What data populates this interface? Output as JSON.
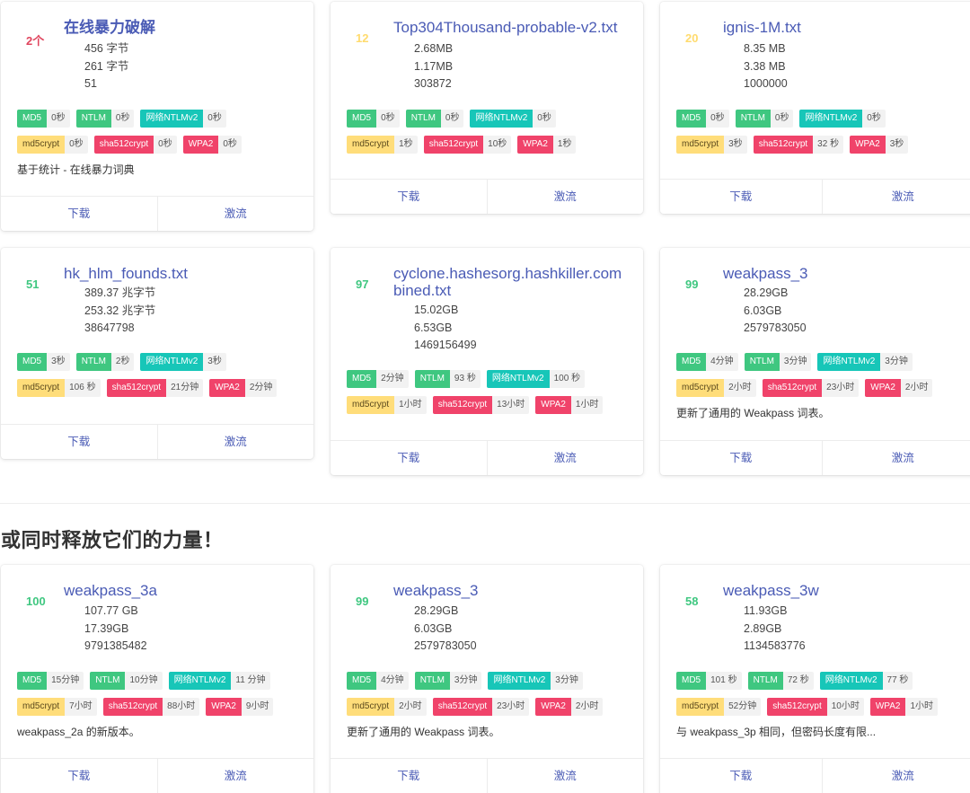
{
  "section": {
    "title": "或同时释放它们的力量！"
  },
  "labels": {
    "download": "下载",
    "torrent": "激流"
  },
  "cards": [
    {
      "rank": "2个",
      "rank_color": "#e0455e",
      "title": "在线暴力破解",
      "bold": true,
      "meta": [
        "456 字节",
        "261 字节",
        "51"
      ],
      "times": {
        "md5": "0秒",
        "ntlm": "0秒",
        "ntv2": "0秒",
        "mdc": "0秒",
        "sha": "0秒",
        "wpa": "0秒"
      },
      "desc": "基于统计 - 在线暴力词典"
    },
    {
      "rank": "12",
      "rank_color": "#ffdb6e",
      "title": "Top304Thousand-probable-v2.txt",
      "meta": [
        "2.68MB",
        "1.17MB",
        "303872"
      ],
      "times": {
        "md5": "0秒",
        "ntlm": "0秒",
        "ntv2": "0秒",
        "mdc": "1秒",
        "sha": "10秒",
        "wpa": "1秒"
      },
      "desc": ""
    },
    {
      "rank": "20",
      "rank_color": "#ffdb6e",
      "title": "ignis-1M.txt",
      "meta": [
        "8.35 MB",
        "3.38 MB",
        "1000000"
      ],
      "times": {
        "md5": "0秒",
        "ntlm": "0秒",
        "ntv2": "0秒",
        "mdc": "3秒",
        "sha": "32 秒",
        "wpa": "3秒"
      },
      "desc": ""
    },
    {
      "rank": "51",
      "rank_color": "#3fc780",
      "title": "hk_hlm_founds.txt",
      "meta": [
        "389.37 兆字节",
        "253.32 兆字节",
        "38647798"
      ],
      "times": {
        "md5": "3秒",
        "ntlm": "2秒",
        "ntv2": "3秒",
        "mdc": "106 秒",
        "sha": "21分钟",
        "wpa": "2分钟"
      },
      "desc": ""
    },
    {
      "rank": "97",
      "rank_color": "#3fc780",
      "title": "cyclone.hashesorg.hashkiller.combined.txt",
      "meta": [
        "15.02GB",
        "6.53GB",
        "1469156499"
      ],
      "times": {
        "md5": "2分钟",
        "ntlm": "93 秒",
        "ntv2": "100 秒",
        "mdc": "1小时",
        "sha": "13小时",
        "wpa": "1小时"
      },
      "desc": ""
    },
    {
      "rank": "99",
      "rank_color": "#3fc780",
      "title": "weakpass_3",
      "meta": [
        "28.29GB",
        "6.03GB",
        "2579783050"
      ],
      "times": {
        "md5": "4分钟",
        "ntlm": "3分钟",
        "ntv2": "3分钟",
        "mdc": "2小时",
        "sha": "23小时",
        "wpa": "2小时"
      },
      "desc": "更新了通用的 Weakpass 词表。"
    },
    {
      "rank": "100",
      "rank_color": "#3fc780",
      "title": "weakpass_3a",
      "meta": [
        "107.77 GB",
        "17.39GB",
        "9791385482"
      ],
      "times": {
        "md5": "15分钟",
        "ntlm": "10分钟",
        "ntv2": "11 分钟",
        "mdc": "7小时",
        "sha": "88小时",
        "wpa": "9小时"
      },
      "desc": "weakpass_2a 的新版本。"
    },
    {
      "rank": "99",
      "rank_color": "#3fc780",
      "title": "weakpass_3",
      "meta": [
        "28.29GB",
        "6.03GB",
        "2579783050"
      ],
      "times": {
        "md5": "4分钟",
        "ntlm": "3分钟",
        "ntv2": "3分钟",
        "mdc": "2小时",
        "sha": "23小时",
        "wpa": "2小时"
      },
      "desc": "更新了通用的 Weakpass 词表。"
    },
    {
      "rank": "58",
      "rank_color": "#3fc780",
      "title": "weakpass_3w",
      "meta": [
        "11.93GB",
        "2.89GB",
        "1134583776"
      ],
      "times": {
        "md5": "101 秒",
        "ntlm": "72 秒",
        "ntv2": "77 秒",
        "mdc": "52分钟",
        "sha": "10小时",
        "wpa": "1小时"
      },
      "desc": "与 weakpass_3p 相同，但密码长度有限..."
    }
  ],
  "hash_types": {
    "md5": "MD5",
    "ntlm": "NTLM",
    "ntv2": "网络NTLMv2",
    "mdc": "md5crypt",
    "sha": "sha512crypt",
    "wpa": "WPA2"
  }
}
